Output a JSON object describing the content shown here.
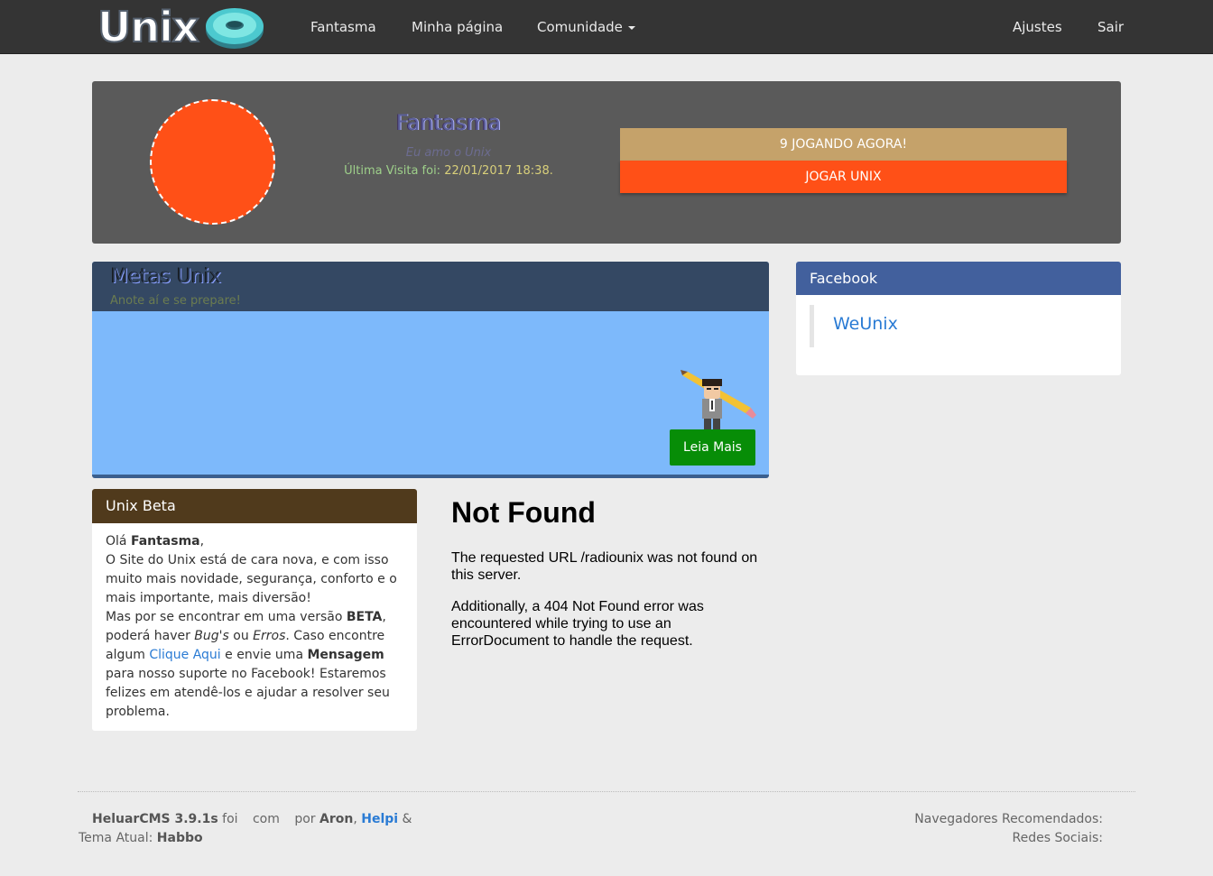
{
  "nav": {
    "logo_text": "Unix",
    "links": [
      "Fantasma",
      "Minha página",
      "Comunidade"
    ],
    "settings": "Ajustes",
    "logout": "Sair"
  },
  "profile": {
    "name": "Fantasma",
    "motto": "Eu amo o Unix",
    "visit_label": "Última Visita foi:",
    "visit_date": "22/01/2017 18:38.",
    "online_button": "9 JOGANDO AGORA!",
    "play_button": "JOGAR UNIX",
    "avatar_color": "#ff5017"
  },
  "metas": {
    "title": "Metas Unix",
    "subtitle": "Anote aí e se prepare!",
    "read_more": "Leia Mais"
  },
  "facebook": {
    "header": "Facebook",
    "link": "WeUnix"
  },
  "beta": {
    "header": "Unix Beta",
    "greeting": "Olá",
    "user": "Fantasma",
    "comma": ",",
    "line1": "O Site do Unix está de cara nova, e com isso muito mais novidade, segurança, conforto e o mais importante, mais diversão!",
    "line2a": "Mas por se encontrar em uma versão",
    "beta_word": "BETA",
    "line2b": ", poderá haver",
    "bugs_word": "Bug's",
    "or_word": "ou",
    "errors_word": "Erros",
    "line2c": ". Caso encontre algum",
    "click_here": "Clique Aqui",
    "line2d": "e envie uma",
    "message_word": "Mensagem",
    "line2e": "para nosso suporte no Facebook! Estaremos felizes em atendê-los e ajudar a resolver seu problema."
  },
  "notfound": {
    "title": "Not Found",
    "p1": "The requested URL /radiounix was not found on this server.",
    "p2": "Additionally, a 404 Not Found error was encountered while trying to use an ErrorDocument to handle the request."
  },
  "footer": {
    "cms": "HeluarCMS 3.9.1s",
    "foi": "foi",
    "com": "com",
    "por": "por",
    "author1": "Aron",
    "author2": "Helpi",
    "amp": "&",
    "theme_label": "Tema Atual:",
    "theme": "Habbo",
    "browsers": "Navegadores Recomendados:",
    "social": "Redes Sociais:"
  }
}
